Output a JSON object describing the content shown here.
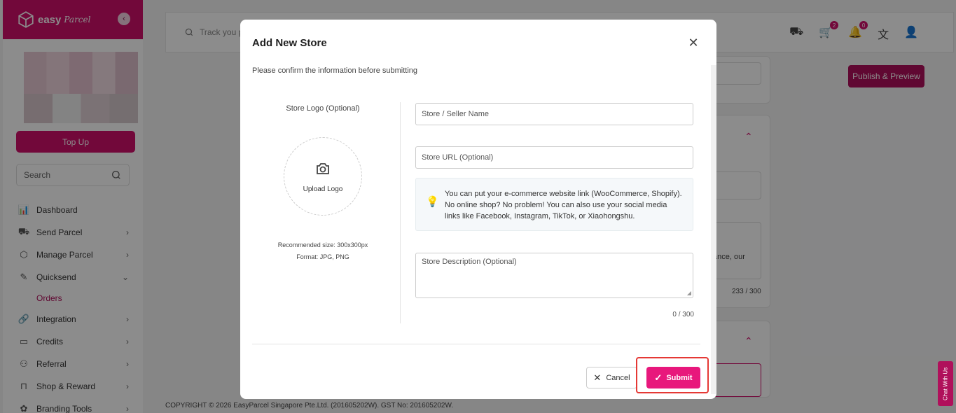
{
  "sidebar": {
    "brand": {
      "name": "easy",
      "script": "Parcel"
    },
    "collapse_icon": "chevron-left-icon",
    "topup_label": "Top Up",
    "search_placeholder": "Search",
    "nav": [
      {
        "label": "Dashboard",
        "icon": "chart-icon",
        "chevron": ""
      },
      {
        "label": "Send Parcel",
        "icon": "truck-icon",
        "chevron": "›"
      },
      {
        "label": "Manage Parcel",
        "icon": "box-icon",
        "chevron": "›"
      },
      {
        "label": "Quicksend",
        "icon": "send-icon",
        "chevron": "⌄"
      },
      {
        "label": "Integration",
        "icon": "link-icon",
        "chevron": "›"
      },
      {
        "label": "Credits",
        "icon": "wallet-icon",
        "chevron": "›"
      },
      {
        "label": "Referral",
        "icon": "user-plus-icon",
        "chevron": "›"
      },
      {
        "label": "Shop & Reward",
        "icon": "shopping-bag-icon",
        "chevron": "›"
      },
      {
        "label": "Branding Tools",
        "icon": "palette-icon",
        "chevron": "›"
      }
    ],
    "sub_item": "Orders"
  },
  "topbar": {
    "track_placeholder": "Track you p",
    "cart_badge": "2",
    "bell_badge": "0"
  },
  "main": {
    "publish_label": "Publish & Preview",
    "partial_text": "tance, our",
    "partial_counter": "233 / 300",
    "footer": "COPYRIGHT © 2026 EasyParcel Singapore Pte.Ltd. (201605202W). GST No: 201605202W.",
    "chat_label": "Chat With Us"
  },
  "modal": {
    "title": "Add New Store",
    "subtitle": "Please confirm the information before submitting",
    "logo_label": "Store Logo (Optional)",
    "upload_label": "Upload Logo",
    "recommended_size": "Recommended size: 300x300px",
    "format": "Format: JPG, PNG",
    "store_name_placeholder": "Store / Seller Name",
    "store_url_placeholder": "Store URL (Optional)",
    "tip": "You can put your e-commerce website link (WooCommerce, Shopify). No online shop? No problem! You can also use your social media links like Facebook, Instagram, TikTok, or Xiaohongshu.",
    "description_placeholder": "Store Description (Optional)",
    "counter": "0 / 300",
    "cancel_label": "Cancel",
    "submit_label": "Submit",
    "highlight_color": "#e53935",
    "accent_color": "#e8187c"
  }
}
